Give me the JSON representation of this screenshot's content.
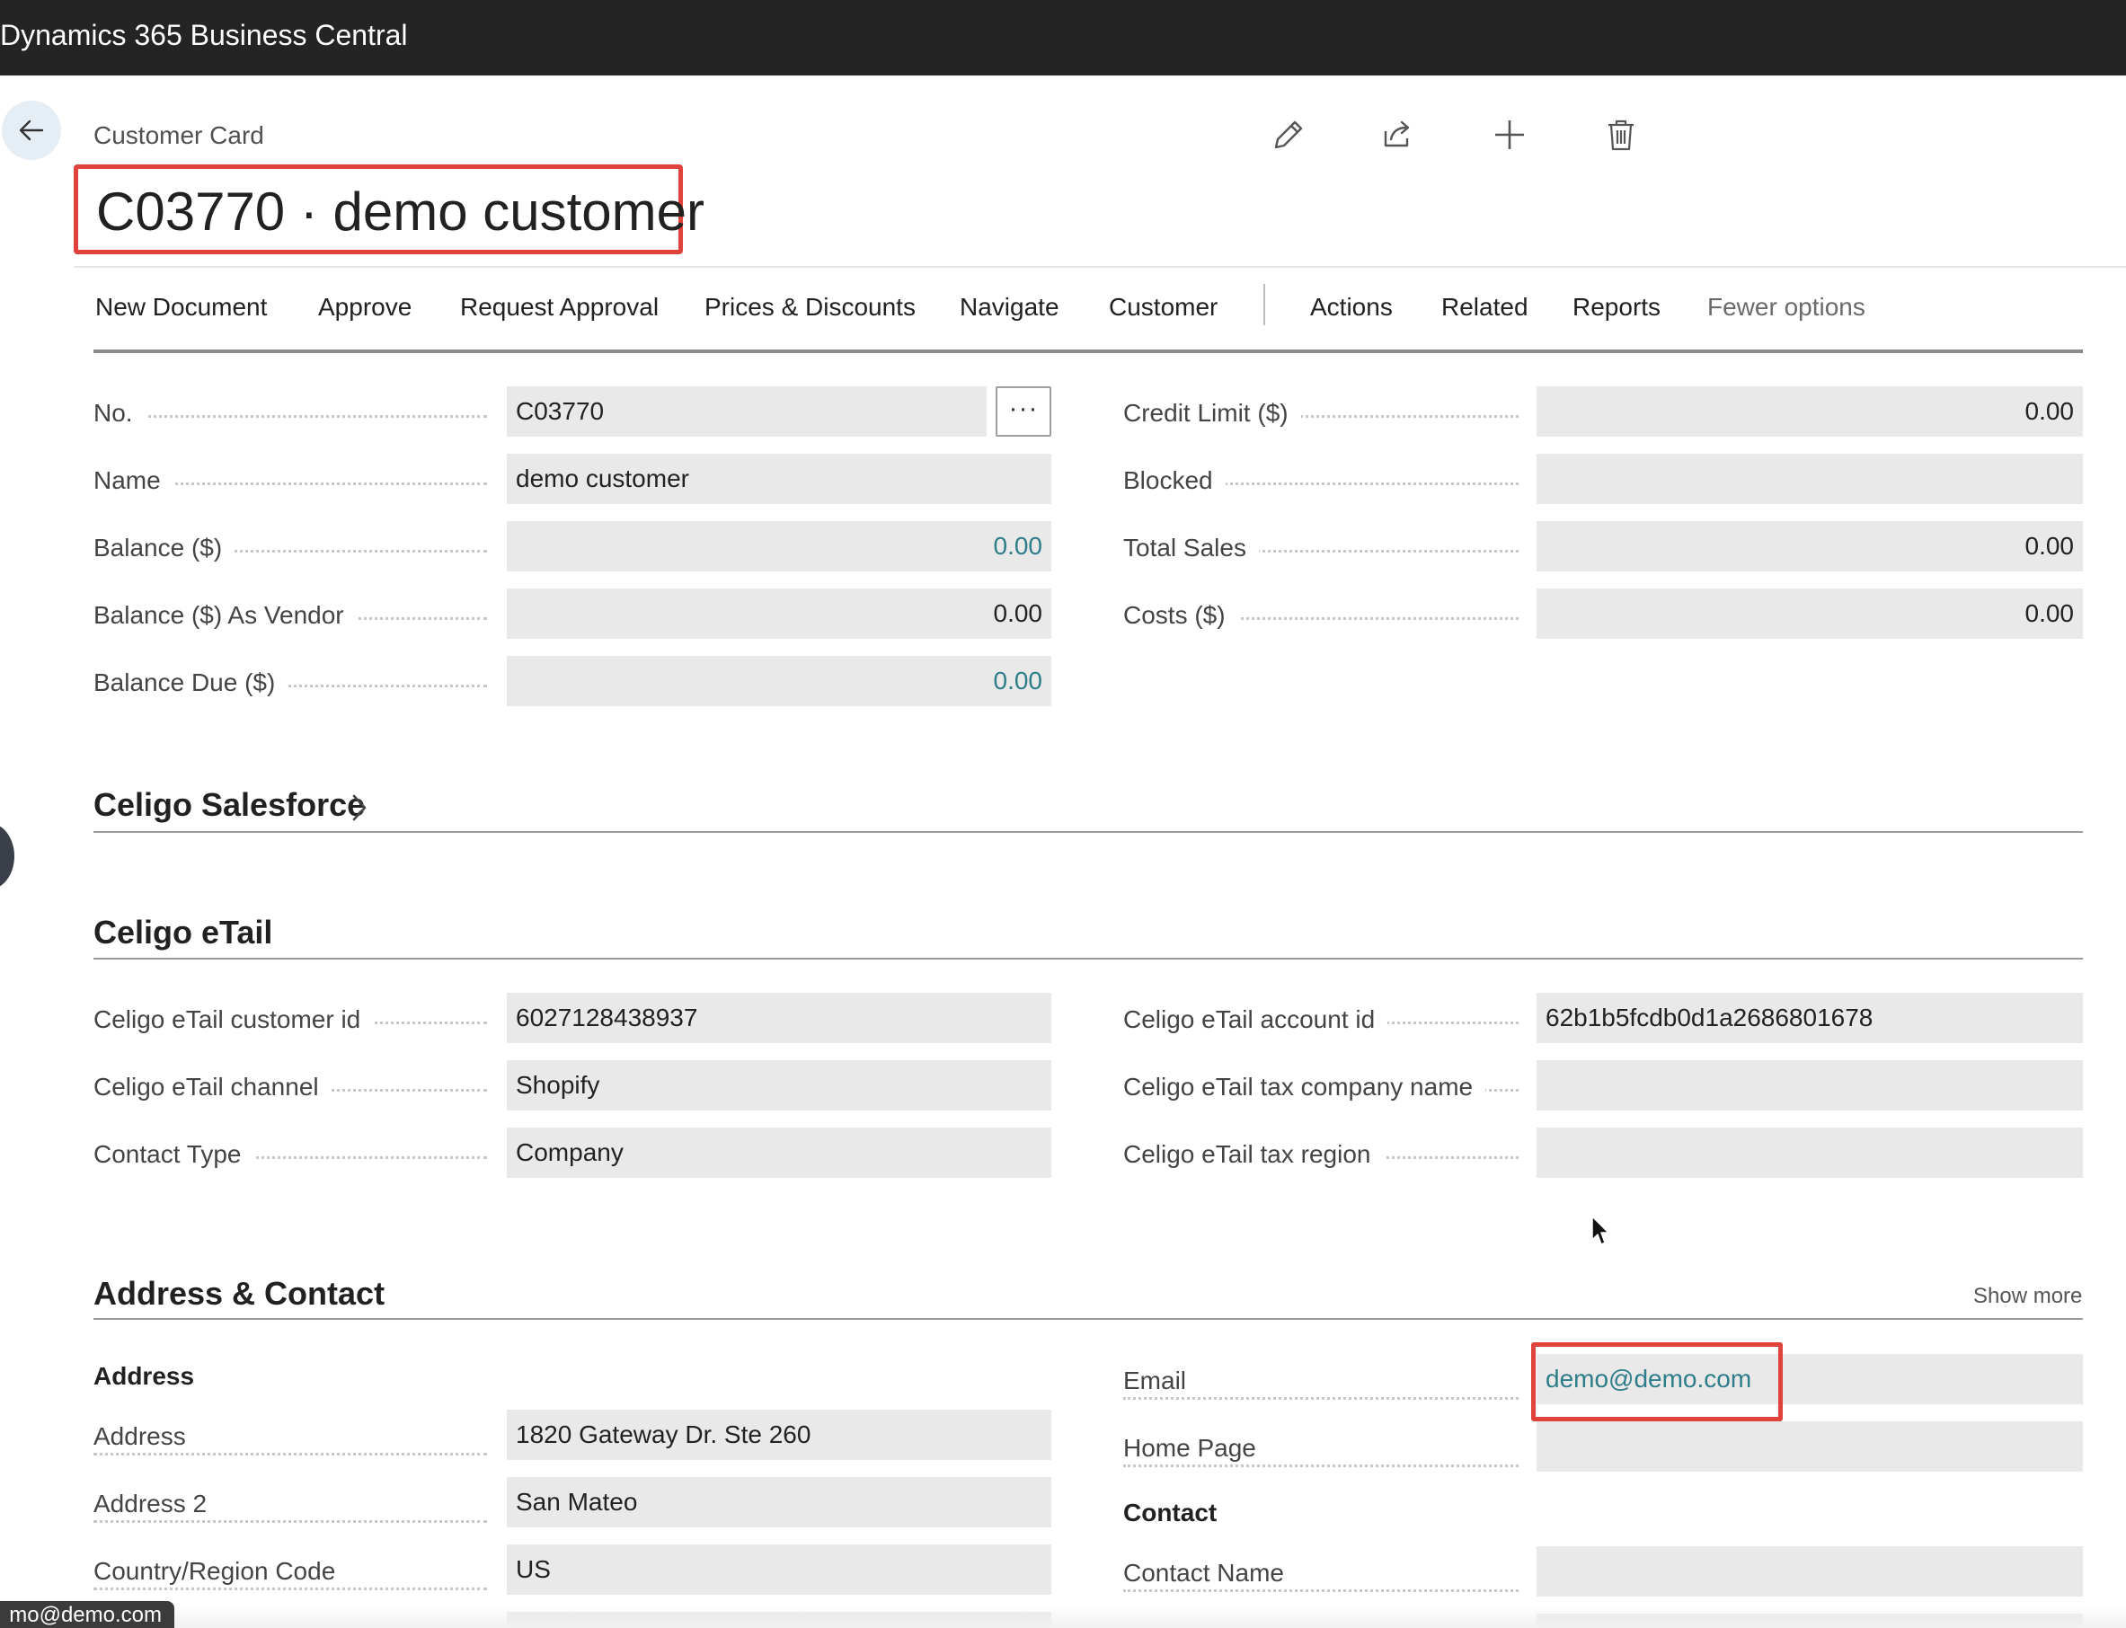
{
  "app": {
    "title": "Dynamics 365 Business Central"
  },
  "page": {
    "caption": "Customer Card",
    "title": "C03770 · demo customer"
  },
  "header_icons": [
    "edit-icon",
    "share-icon",
    "add-icon",
    "delete-icon"
  ],
  "actions": {
    "items": [
      "New Document",
      "Approve",
      "Request Approval",
      "Prices & Discounts",
      "Navigate",
      "Customer",
      "Actions",
      "Related",
      "Reports"
    ],
    "fewer_options": "Fewer options"
  },
  "general": {
    "left": [
      {
        "label": "No.",
        "value": "C03770"
      },
      {
        "label": "Name",
        "value": "demo customer"
      },
      {
        "label": "Balance ($)",
        "value": "0.00"
      },
      {
        "label": "Balance ($) As Vendor",
        "value": "0.00"
      },
      {
        "label": "Balance Due ($)",
        "value": "0.00"
      }
    ],
    "assist_label": "···",
    "right": [
      {
        "label": "Credit Limit ($)",
        "value": "0.00"
      },
      {
        "label": "Blocked",
        "value": ""
      },
      {
        "label": "Total Sales",
        "value": "0.00"
      },
      {
        "label": "Costs ($)",
        "value": "0.00"
      }
    ]
  },
  "celigo_salesforce": {
    "title": "Celigo Salesforce"
  },
  "celigo_etail": {
    "title": "Celigo eTail",
    "left": [
      {
        "label": "Celigo eTail customer id",
        "value": "6027128438937"
      },
      {
        "label": "Celigo eTail channel",
        "value": "Shopify"
      },
      {
        "label": "Contact Type",
        "value": "Company"
      }
    ],
    "right": [
      {
        "label": "Celigo eTail account id",
        "value": "62b1b5fcdb0d1a2686801678"
      },
      {
        "label": "Celigo eTail tax company name",
        "value": ""
      },
      {
        "label": "Celigo eTail tax region",
        "value": ""
      }
    ]
  },
  "address_contact": {
    "title": "Address & Contact",
    "show_more": "Show more",
    "address_group": "Address",
    "left": [
      {
        "label": "Address",
        "value": "1820 Gateway Dr. Ste 260"
      },
      {
        "label": "Address 2",
        "value": "San Mateo"
      },
      {
        "label": "Country/Region Code",
        "value": "US"
      }
    ],
    "right": [
      {
        "label": "Email",
        "value": "demo@demo.com"
      },
      {
        "label": "Home Page",
        "value": ""
      }
    ],
    "contact_group": "Contact",
    "contact_fields": [
      {
        "label": "Contact Name",
        "value": ""
      }
    ]
  },
  "status_tooltip": "mo@demo.com",
  "colors": {
    "topbar": "#242424",
    "highlight": "#e0433c",
    "link": "#2e7d8a",
    "field_bg": "#e9e9e9"
  }
}
